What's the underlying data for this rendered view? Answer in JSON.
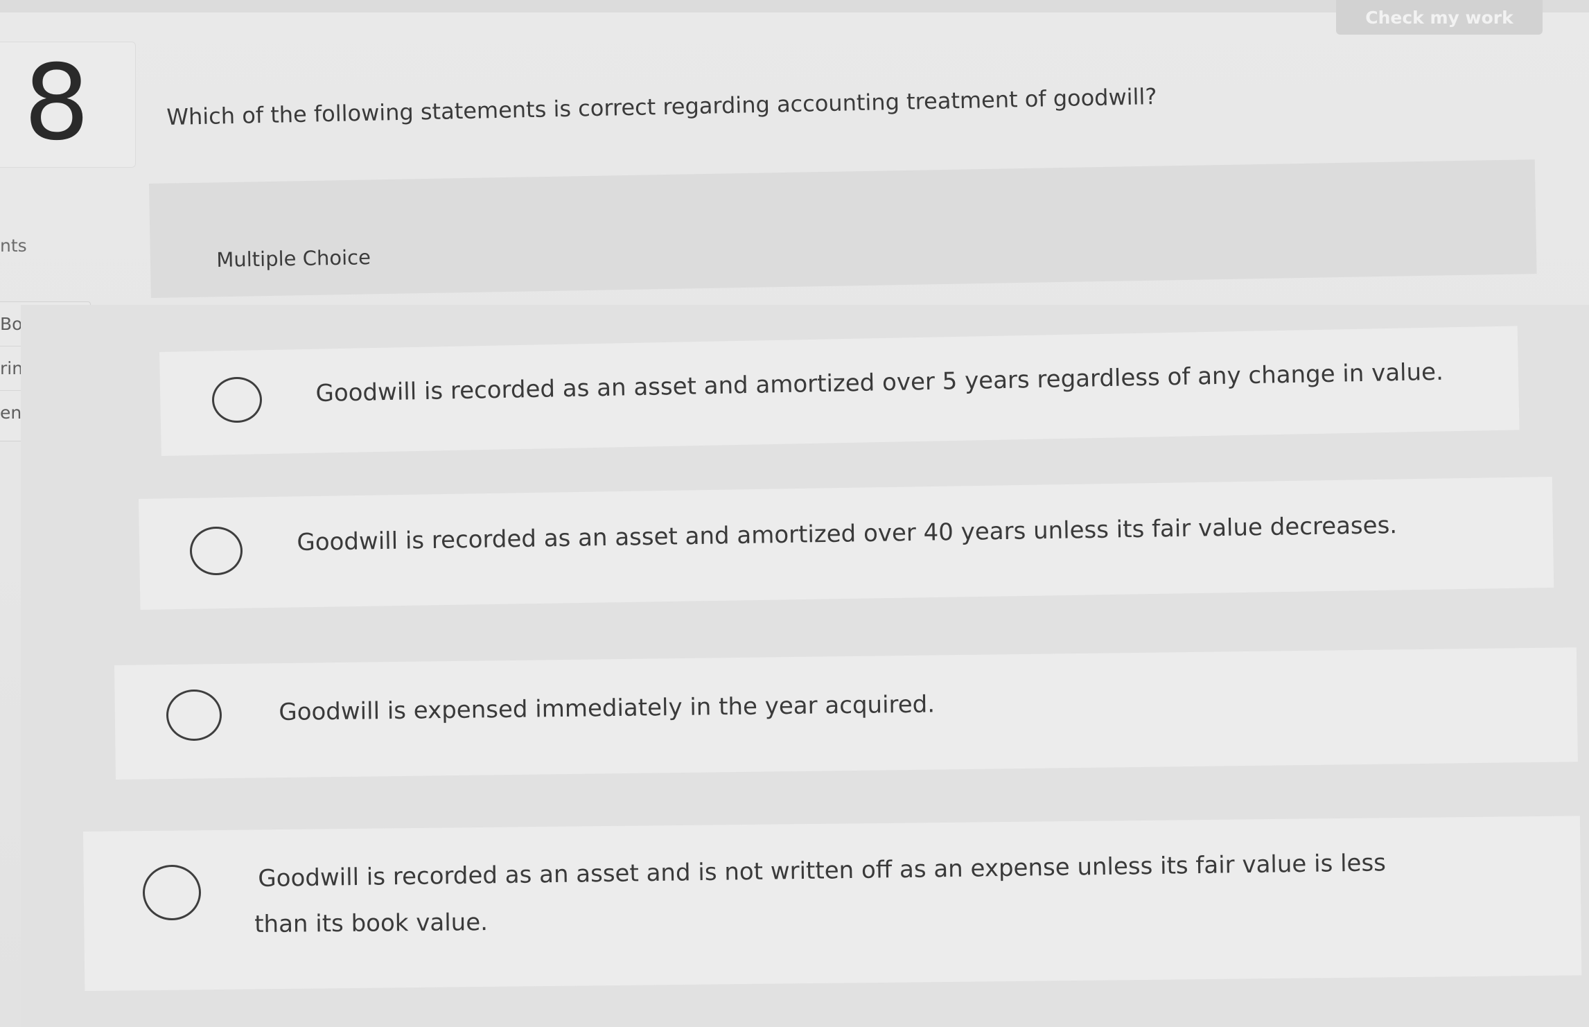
{
  "header": {
    "check_button_label": "Check my work"
  },
  "question": {
    "number": "8",
    "text": "Which of the following statements is correct regarding accounting treatment of goodwill?",
    "type_label": "Multiple Choice"
  },
  "sidebar": {
    "points_label_partial": "nts",
    "menu_items": [
      {
        "label": "Book"
      },
      {
        "label": "rint"
      },
      {
        "label": "ences"
      }
    ]
  },
  "choices": [
    {
      "text": "Goodwill is recorded as an asset and amortized over 5 years regardless of any change in value.",
      "selected": false
    },
    {
      "text": "Goodwill is recorded as an asset and amortized over 40 years unless its fair value decreases.",
      "selected": false
    },
    {
      "text": "Goodwill is expensed immediately in the year acquired.",
      "selected": false
    },
    {
      "text_line1": "Goodwill is recorded as an asset and is not written off as an expense unless its fair value is less",
      "text_line2": "than its book value.",
      "selected": false
    }
  ]
}
